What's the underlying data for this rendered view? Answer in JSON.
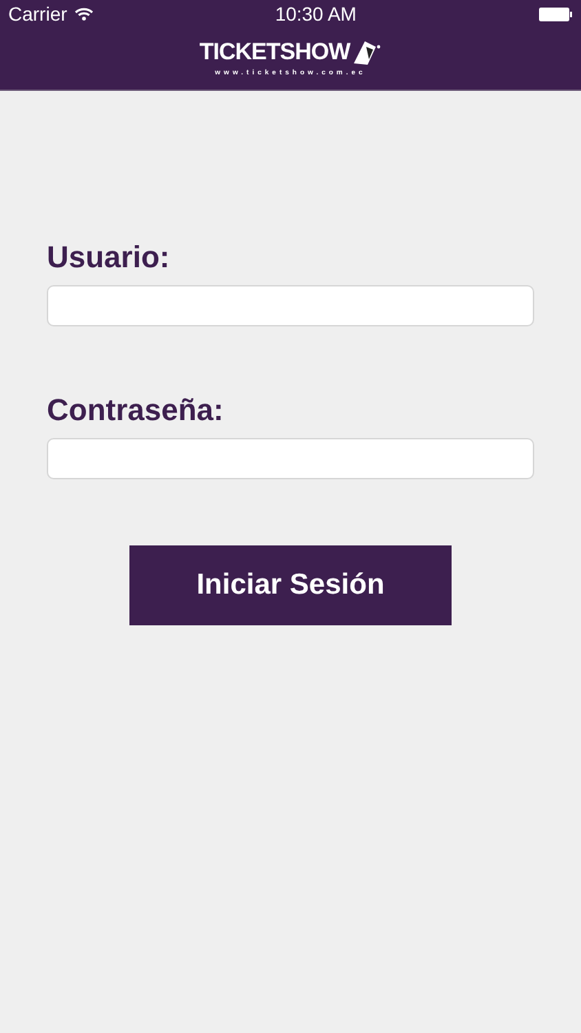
{
  "status_bar": {
    "carrier": "Carrier",
    "time": "10:30 AM"
  },
  "header": {
    "logo": "TICKETSHOW",
    "url": "www.ticketshow.com.ec"
  },
  "form": {
    "fields": [
      {
        "label": "Usuario:"
      },
      {
        "label": "Contraseña:"
      }
    ],
    "button": "Iniciar Sesión"
  }
}
